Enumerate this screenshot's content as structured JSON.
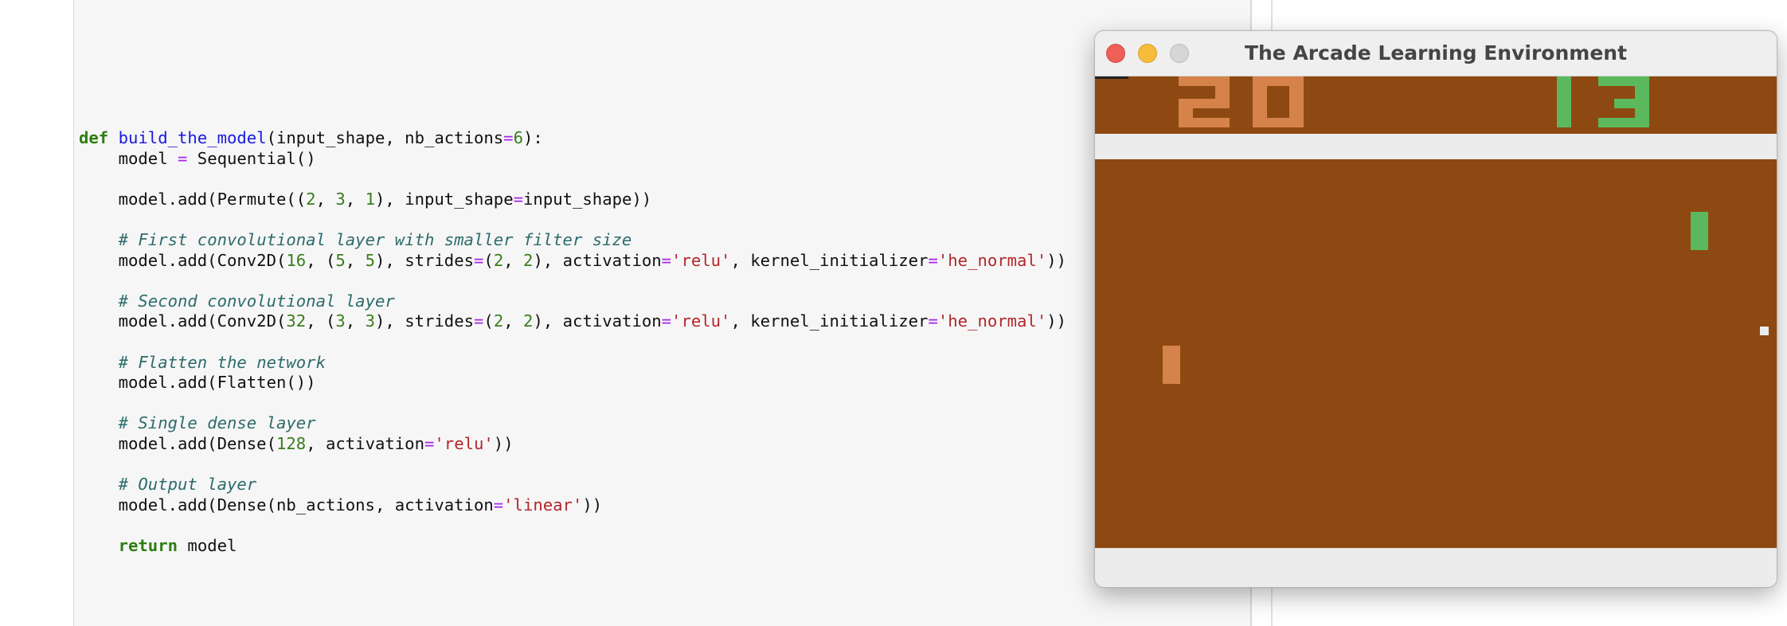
{
  "notebook": {
    "code_lines": [
      [
        {
          "t": "def",
          "c": "kw"
        },
        {
          "t": " "
        },
        {
          "t": "build_the_model",
          "c": "fn"
        },
        {
          "t": "(input_shape, nb_actions"
        },
        {
          "t": "=",
          "c": "op"
        },
        {
          "t": "6",
          "c": "num"
        },
        {
          "t": "):"
        }
      ],
      [
        {
          "t": "    model "
        },
        {
          "t": "=",
          "c": "op"
        },
        {
          "t": " Sequential()"
        }
      ],
      [],
      [
        {
          "t": "    model.add(Permute(("
        },
        {
          "t": "2",
          "c": "num"
        },
        {
          "t": ", "
        },
        {
          "t": "3",
          "c": "num"
        },
        {
          "t": ", "
        },
        {
          "t": "1",
          "c": "num"
        },
        {
          "t": "), input_shape"
        },
        {
          "t": "=",
          "c": "op"
        },
        {
          "t": "input_shape))"
        }
      ],
      [],
      [
        {
          "t": "    "
        },
        {
          "t": "# First convolutional layer with smaller filter size",
          "c": "cm"
        }
      ],
      [
        {
          "t": "    model.add(Conv2D("
        },
        {
          "t": "16",
          "c": "num"
        },
        {
          "t": ", ("
        },
        {
          "t": "5",
          "c": "num"
        },
        {
          "t": ", "
        },
        {
          "t": "5",
          "c": "num"
        },
        {
          "t": "), strides"
        },
        {
          "t": "=",
          "c": "op"
        },
        {
          "t": "("
        },
        {
          "t": "2",
          "c": "num"
        },
        {
          "t": ", "
        },
        {
          "t": "2",
          "c": "num"
        },
        {
          "t": "), activation"
        },
        {
          "t": "=",
          "c": "op"
        },
        {
          "t": "'relu'",
          "c": "str"
        },
        {
          "t": ", kernel_initializer"
        },
        {
          "t": "=",
          "c": "op"
        },
        {
          "t": "'he_normal'",
          "c": "str"
        },
        {
          "t": "))"
        }
      ],
      [],
      [
        {
          "t": "    "
        },
        {
          "t": "# Second convolutional layer",
          "c": "cm"
        }
      ],
      [
        {
          "t": "    model.add(Conv2D("
        },
        {
          "t": "32",
          "c": "num"
        },
        {
          "t": ", ("
        },
        {
          "t": "3",
          "c": "num"
        },
        {
          "t": ", "
        },
        {
          "t": "3",
          "c": "num"
        },
        {
          "t": "), strides"
        },
        {
          "t": "=",
          "c": "op"
        },
        {
          "t": "("
        },
        {
          "t": "2",
          "c": "num"
        },
        {
          "t": ", "
        },
        {
          "t": "2",
          "c": "num"
        },
        {
          "t": "), activation"
        },
        {
          "t": "=",
          "c": "op"
        },
        {
          "t": "'relu'",
          "c": "str"
        },
        {
          "t": ", kernel_initializer"
        },
        {
          "t": "=",
          "c": "op"
        },
        {
          "t": "'he_normal'",
          "c": "str"
        },
        {
          "t": "))"
        }
      ],
      [],
      [
        {
          "t": "    "
        },
        {
          "t": "# Flatten the network",
          "c": "cm"
        }
      ],
      [
        {
          "t": "    model.add(Flatten())"
        }
      ],
      [],
      [
        {
          "t": "    "
        },
        {
          "t": "# Single dense layer",
          "c": "cm"
        }
      ],
      [
        {
          "t": "    model.add(Dense("
        },
        {
          "t": "128",
          "c": "num"
        },
        {
          "t": ", activation"
        },
        {
          "t": "=",
          "c": "op"
        },
        {
          "t": "'relu'",
          "c": "str"
        },
        {
          "t": "))"
        }
      ],
      [],
      [
        {
          "t": "    "
        },
        {
          "t": "# Output layer",
          "c": "cm"
        }
      ],
      [
        {
          "t": "    model.add(Dense(nb_actions, activation"
        },
        {
          "t": "=",
          "c": "op"
        },
        {
          "t": "'linear'",
          "c": "str"
        },
        {
          "t": "))"
        }
      ],
      [],
      [
        {
          "t": "    "
        },
        {
          "t": "return",
          "c": "kw"
        },
        {
          "t": " model"
        }
      ]
    ]
  },
  "window": {
    "title": "The Arcade Learning Environment",
    "controls": {
      "close_icon": "red-traffic-light",
      "minimize_icon": "yellow-traffic-light",
      "zoom_icon": "gray-traffic-light"
    }
  },
  "game": {
    "name": "Pong",
    "score_left": "20",
    "score_right": "13",
    "colors": {
      "field": "#8e4912",
      "wall": "#ececec",
      "left_player": "#d5834a",
      "right_player": "#5cb85c",
      "ball": "#ececec"
    }
  }
}
